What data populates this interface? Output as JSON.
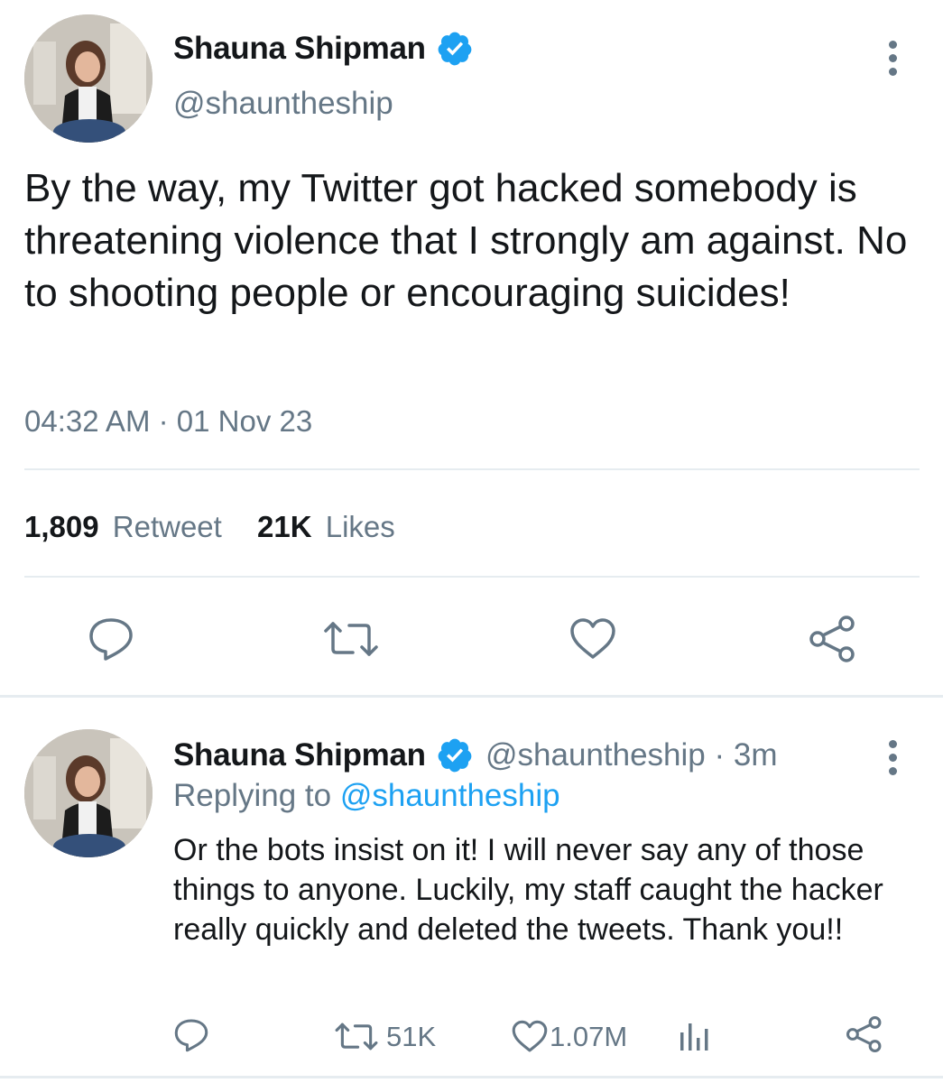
{
  "main_tweet": {
    "author_name": "Shauna Shipman",
    "author_handle": "@shauntheship",
    "text": "By the way, my Twitter got hacked somebody is threatening violence that I strongly am against. No to shooting people or encouraging suicides!",
    "timestamp": "04:32 AM · 01 Nov 23",
    "retweet_count": "1,809",
    "retweet_label": "Retweet",
    "like_count": "21K",
    "like_label": "Likes"
  },
  "reply_tweet": {
    "author_name": "Shauna Shipman",
    "author_handle_time": "@shauntheship · 3m",
    "replying_prefix": "Replying to",
    "replying_handle": "@shauntheship",
    "text": "Or the bots insist on it! I will never say any of those things to anyone. Luckily, my staff caught the hacker really quickly and deleted the tweets. Thank you!!",
    "retweet_count": "51K",
    "like_count": "1.07M"
  },
  "colors": {
    "accent": "#1da1f2",
    "muted": "#657786",
    "text": "#14171a",
    "divider": "#e6ecf0"
  },
  "icons": [
    "verified-badge-icon",
    "more-icon",
    "reply-icon",
    "retweet-icon",
    "like-icon",
    "share-icon",
    "analytics-icon"
  ]
}
